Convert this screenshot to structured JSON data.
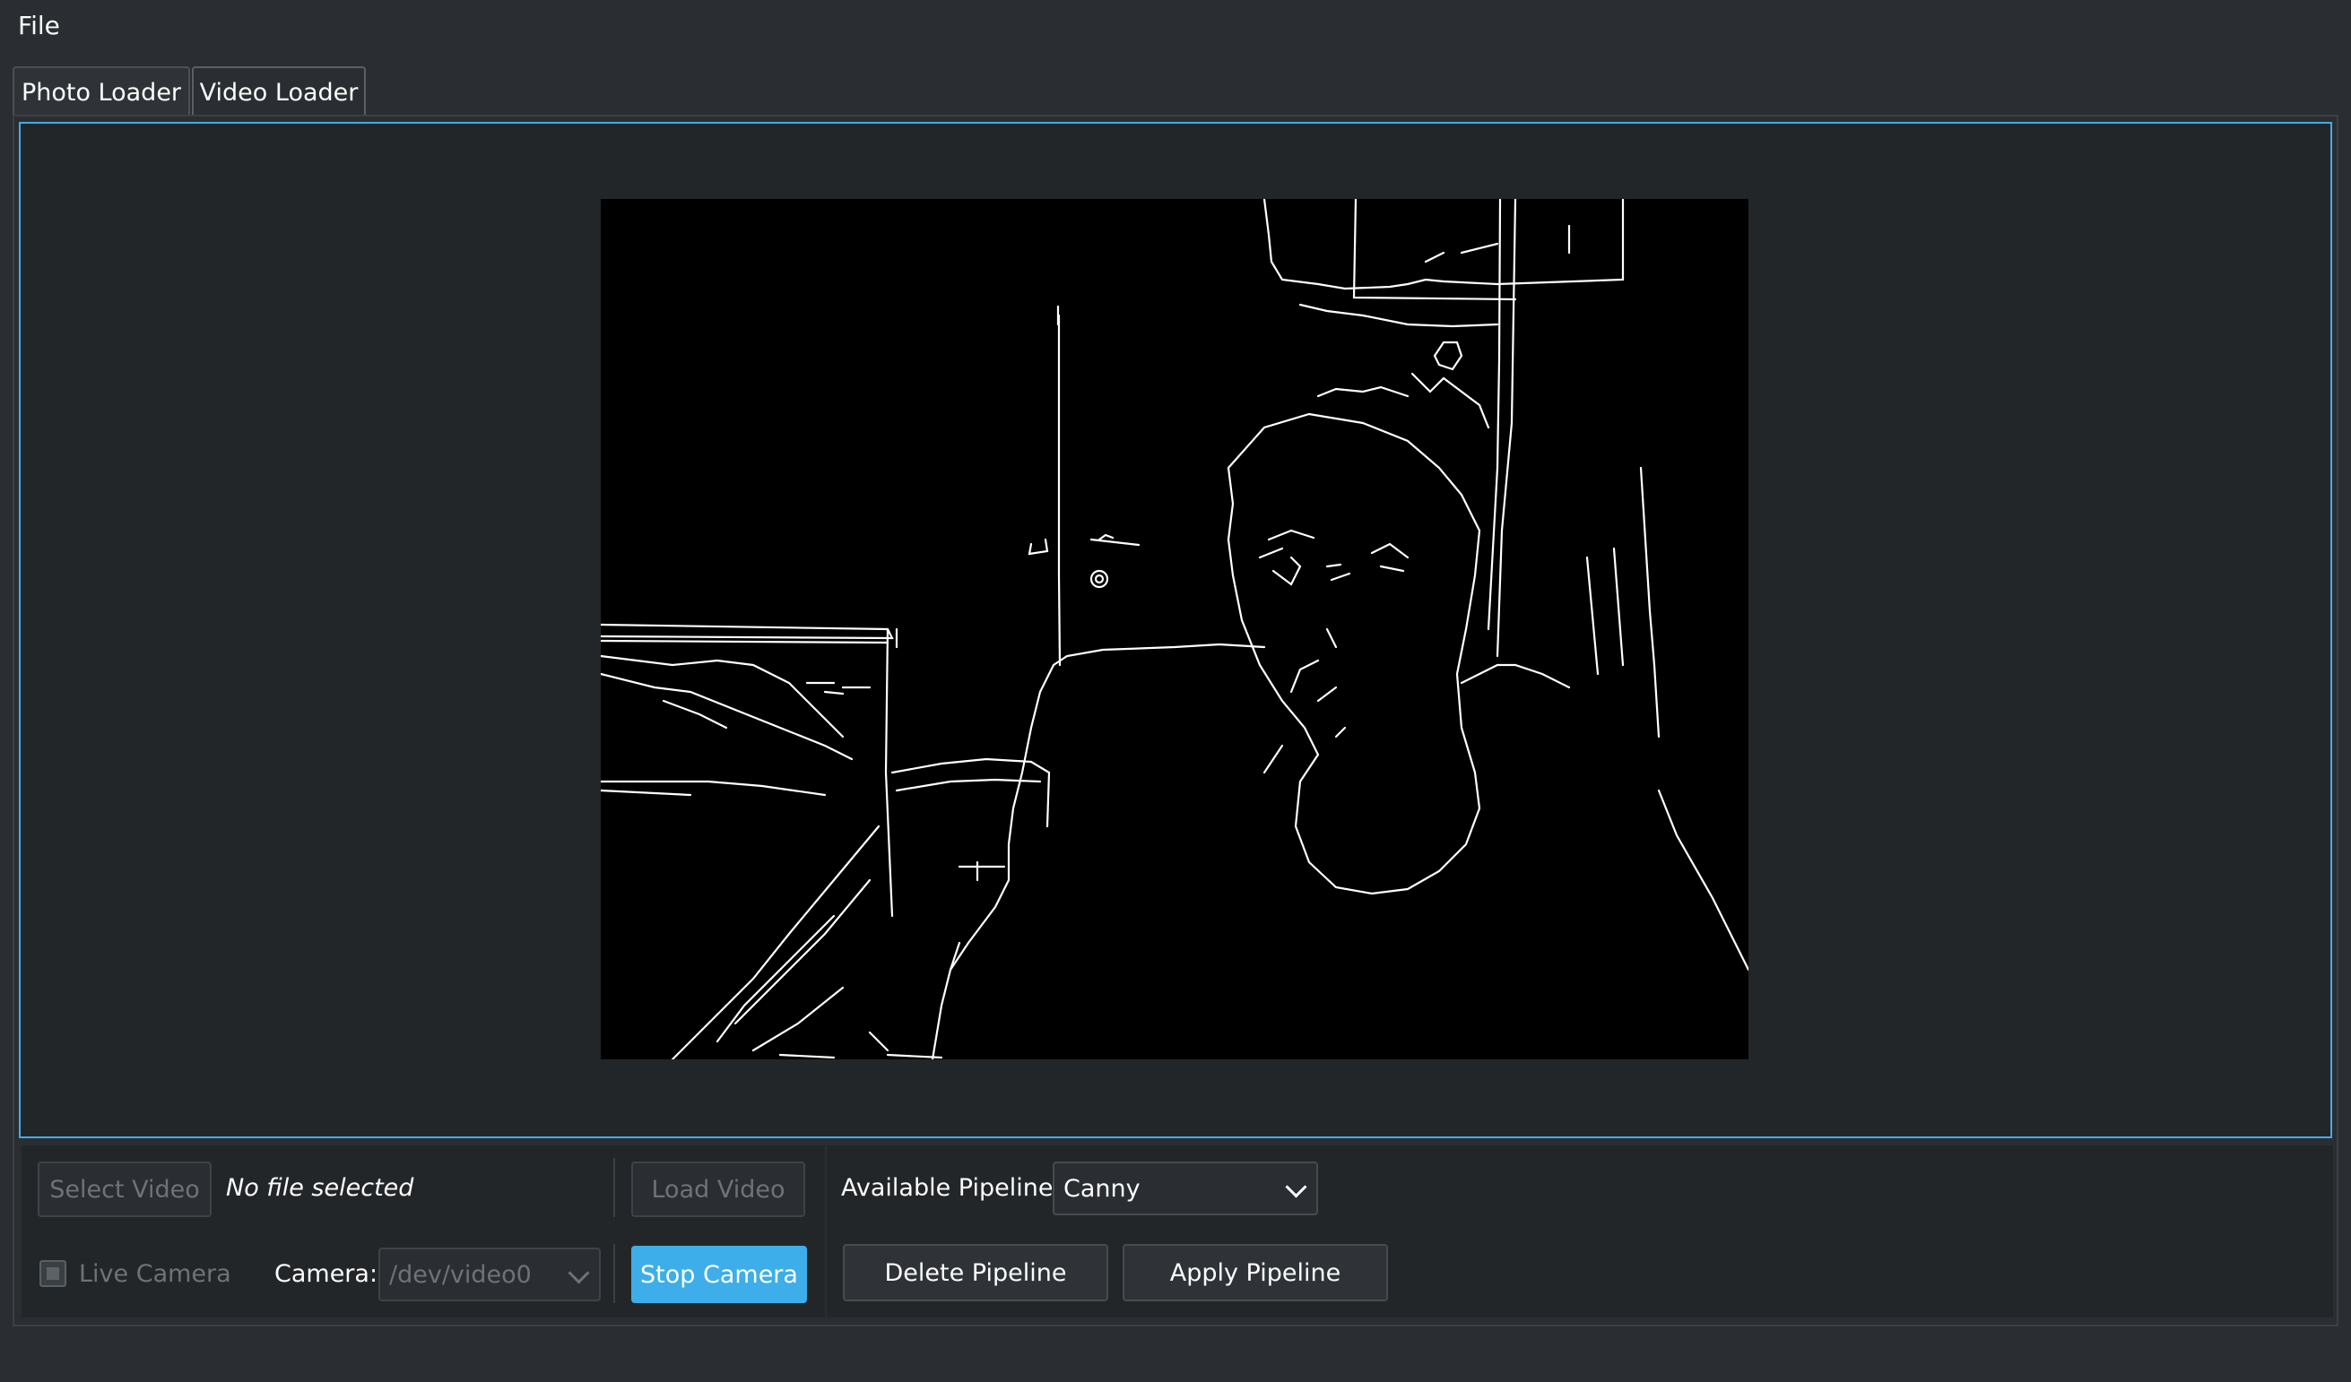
{
  "menubar": {
    "file": "File"
  },
  "tabs": [
    {
      "label": "Photo Loader",
      "active": false
    },
    {
      "label": "Video Loader",
      "active": true
    }
  ],
  "video": {
    "filter": "Canny edge output (live camera)"
  },
  "controls": {
    "select_video": "Select Video",
    "file_status": "No file selected",
    "load_video": "Load Video",
    "live_camera": "Live Camera",
    "live_camera_checked": false,
    "camera_label": "Camera:",
    "camera_value": "/dev/video0",
    "stop_camera": "Stop Camera",
    "pipeline_label": "Available Pipeline:",
    "pipeline_value": "Canny",
    "delete_pipeline": "Delete Pipeline",
    "apply_pipeline": "Apply Pipeline"
  },
  "colors": {
    "accent": "#3daee9",
    "background": "#2a2e32",
    "panel": "#232629"
  }
}
